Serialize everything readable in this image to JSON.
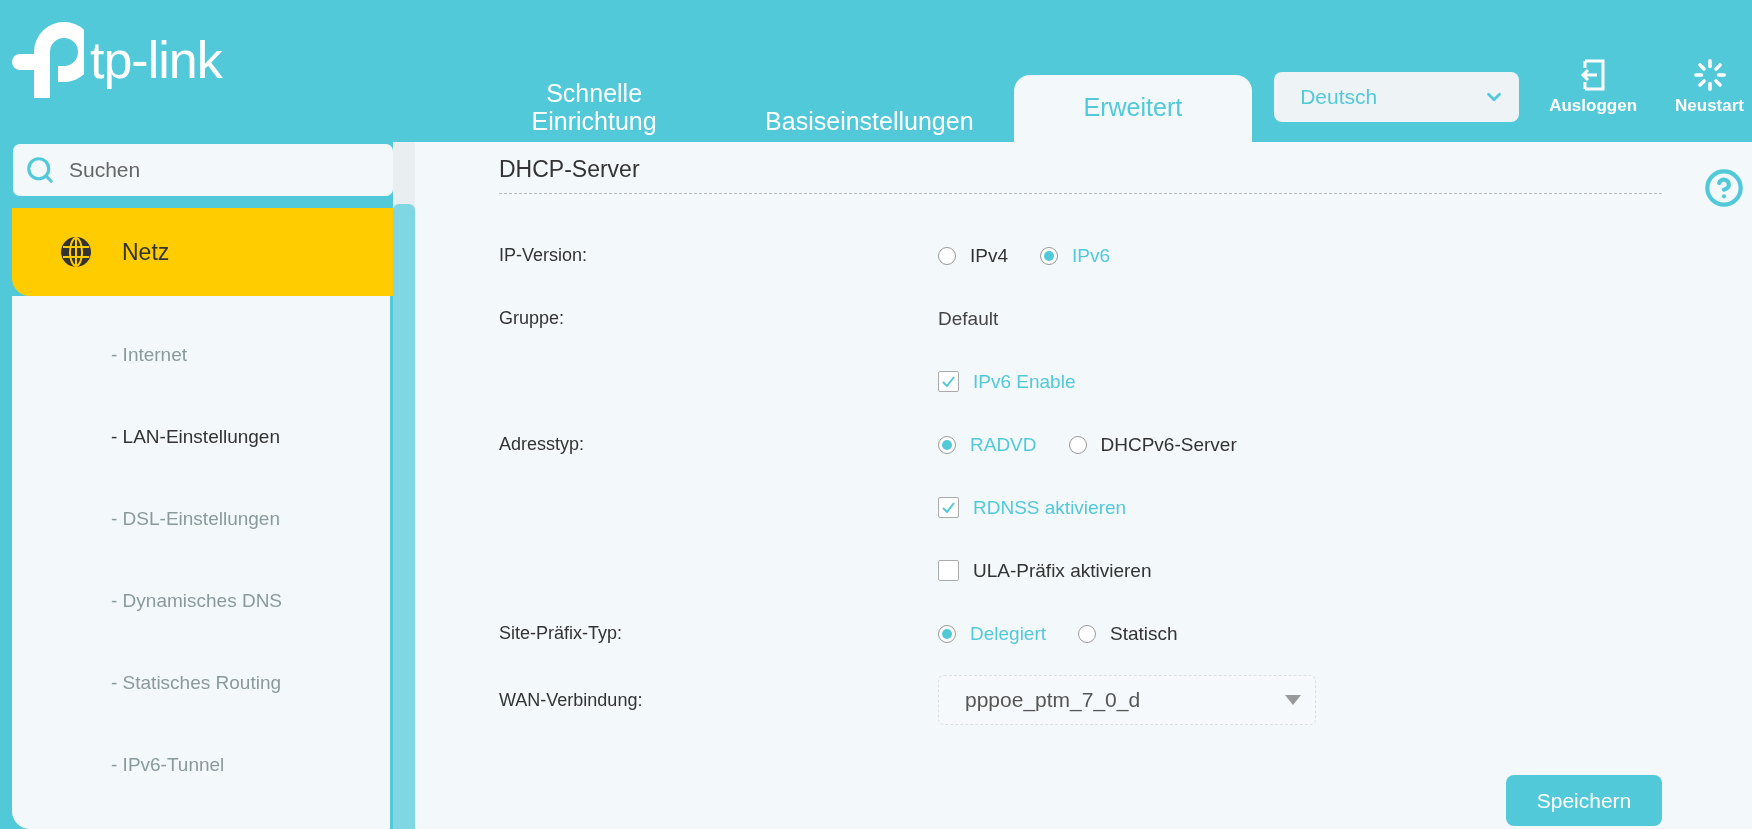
{
  "header": {
    "logo_text": "tp-link",
    "tabs": [
      {
        "label": "Schnelle Einrichtung",
        "selected": false
      },
      {
        "label": "Basiseinstellungen",
        "selected": false
      },
      {
        "label": "Erweitert",
        "selected": true
      }
    ],
    "language": "Deutsch",
    "actions": [
      {
        "kind": "logout",
        "label": "Ausloggen"
      },
      {
        "kind": "restart",
        "label": "Neustart"
      }
    ]
  },
  "sidebar": {
    "search": {
      "placeholder": "Suchen"
    },
    "section": {
      "label": "Netz",
      "expanded": true
    },
    "items": [
      {
        "label": "- Internet",
        "selected": false
      },
      {
        "label": "- LAN-Einstellungen",
        "selected": true
      },
      {
        "label": "- DSL-Einstellungen",
        "selected": false
      },
      {
        "label": "- Dynamisches DNS",
        "selected": false
      },
      {
        "label": "- Statisches Routing",
        "selected": false
      },
      {
        "label": "- IPv6-Tunnel",
        "selected": false
      }
    ]
  },
  "content": {
    "title": "DHCP-Server",
    "rows": [
      {
        "kind": "radio",
        "label": "IP-Version:",
        "options": [
          {
            "label": "IPv4",
            "selected": false
          },
          {
            "label": "IPv6",
            "selected": true
          }
        ]
      },
      {
        "kind": "text",
        "label": "Gruppe:",
        "value": "Default"
      },
      {
        "kind": "checkbox",
        "option": {
          "label": "IPv6 Enable",
          "checked": true
        }
      },
      {
        "kind": "radio",
        "label": "Adresstyp:",
        "options": [
          {
            "label": "RADVD",
            "selected": true
          },
          {
            "label": "DHCPv6-Server",
            "selected": false
          }
        ]
      },
      {
        "kind": "checkbox",
        "option": {
          "label": "RDNSS aktivieren",
          "checked": true
        }
      },
      {
        "kind": "checkbox",
        "option": {
          "label": "ULA-Präfix aktivieren",
          "checked": false
        }
      },
      {
        "kind": "radio",
        "label": "Site-Präfix-Typ:",
        "options": [
          {
            "label": "Delegiert",
            "selected": true
          },
          {
            "label": "Statisch",
            "selected": false
          }
        ]
      },
      {
        "kind": "select",
        "label": "WAN-Verbindung:",
        "value": "pppoe_ptm_7_0_d"
      }
    ],
    "save_button": "Speichern"
  }
}
